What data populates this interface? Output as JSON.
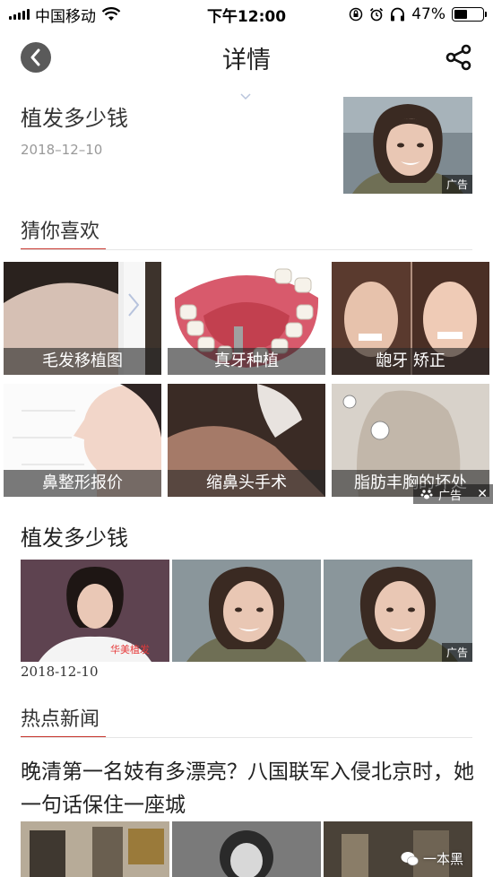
{
  "status_bar": {
    "carrier": "中国移动",
    "time": "下午12:00",
    "battery_percent": "47%",
    "battery_level": 0.47,
    "icons": [
      "signal-icon",
      "wifi-icon",
      "orientation-lock-icon",
      "alarm-icon",
      "headphones-icon",
      "battery-icon"
    ]
  },
  "nav": {
    "title": "详情",
    "back_icon": "back-chevron-icon",
    "share_icon": "share-icon"
  },
  "top_article": {
    "title": "植发多少钱",
    "date": "2018–12–10",
    "ad_label": "广告"
  },
  "recommend": {
    "section_title": "猜你喜欢",
    "items": [
      {
        "label": "毛发移植图"
      },
      {
        "label": "真牙种植"
      },
      {
        "label": "龅牙 矫正"
      },
      {
        "label": "鼻整形报价"
      },
      {
        "label": "缩鼻头手术"
      },
      {
        "label": "脂肪丰胸的坏处"
      }
    ],
    "ad_label": "广告",
    "close_icon": "close-icon"
  },
  "article2": {
    "title": "植发多少钱",
    "date": "2018-12-10",
    "ad_label": "广告",
    "thumb_overlay_text": "华美植发"
  },
  "hot_news": {
    "section_title": "热点新闻",
    "headline": "晚清第一名妓有多漂亮？八国联军入侵北京时，她一句话保住一座城",
    "watermark": "一本黑"
  },
  "colors": {
    "accent_red": "#c8372f",
    "text_dark": "#222222",
    "text_muted": "#999999"
  }
}
